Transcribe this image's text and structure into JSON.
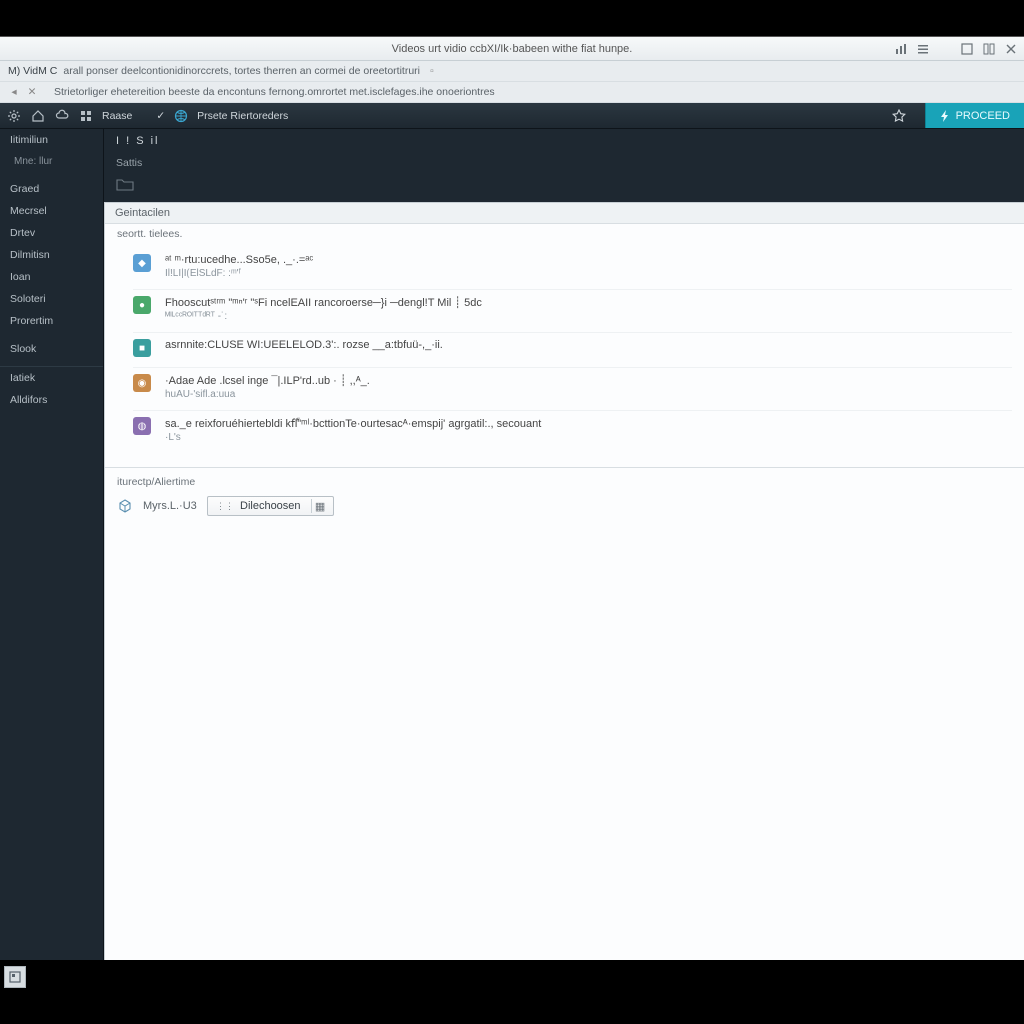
{
  "title": "Videos urt vidio ccbXI/Ik·babeen withe fiat hunpe.",
  "subheader1_prefix": "M) VidM C",
  "subheader1": "arall ponser deelcontionidinorccrets, tortes therren an cormei de oreetortitruri",
  "subheader2": "Strietorliger ehetereition beeste da encontuns fernong.omrortet met.isclefages.ihe onoeriontres",
  "toolbar": {
    "label1": "Raase",
    "label2": "Prsete Riertoreders",
    "proceed": "PROCEED"
  },
  "sidebar": {
    "items": [
      {
        "label": "Iitimiliun"
      },
      {
        "label": "Mne: llur",
        "sub": true
      },
      {
        "label": "Graed"
      },
      {
        "label": "Mecrsel"
      },
      {
        "label": "Drtev"
      },
      {
        "label": "Dilmitisn"
      },
      {
        "label": "Ioan"
      },
      {
        "label": "Soloteri"
      },
      {
        "label": "Prorertim"
      },
      {
        "label": "Slook"
      }
    ],
    "group2": [
      {
        "label": "Iatiek"
      },
      {
        "label": "Alldifors"
      }
    ]
  },
  "strip": {
    "row1": "I ! S   il",
    "row2": "Sattis"
  },
  "panel": {
    "header": "Geintacilen",
    "section1_label": "seortt. tielees.",
    "activity": [
      {
        "avatar": "blue",
        "line1": "ᵃᵗ  ᵐ·rtu:ucedhe...Sso5e, ._·.=ᵃᶜ",
        "line2": "Il!LI|I⟮ElSLdF:    :ᵐ'ᶠ"
      },
      {
        "avatar": "green",
        "line1": "Fhooscutˢᵗʳᵐ    \"ᵐⁿ'ʳ \"ˢFi   ncelEAII    rancoroerse─}i   ─dengl!T  Mil ┊  5dc",
        "line2": "ᴹᴵᴸᶜᶜᴿᴼᴵᵀᵀᵈᴿᵀ -˙:"
      },
      {
        "avatar": "teal",
        "line1": "asrnnite:CLUSE  WI:UEELELOD.3':. rozse  __a:tbfuü-,_·ii.",
        "line2": ""
      },
      {
        "avatar": "orange",
        "line1": "·Adae  Ade   .lcsel  inge   ¯|.ILP'rd..ub · ┊ ,,ᴬ_.",
        "line2": "huAU-'sifl.a:uua"
      },
      {
        "avatar": "purple",
        "line1": "sa._e   reixforuéhiertebldi kfّl\"ᵐˡ·bcttionTe·ourtesacᴬ·emspij' agrgatil:.,    secouant",
        "line2": "·L's"
      }
    ],
    "secondary_header": "iturectp/Aliertime",
    "config": {
      "label": "Myrs.L.·U3",
      "button": "Dilechoosen"
    }
  }
}
